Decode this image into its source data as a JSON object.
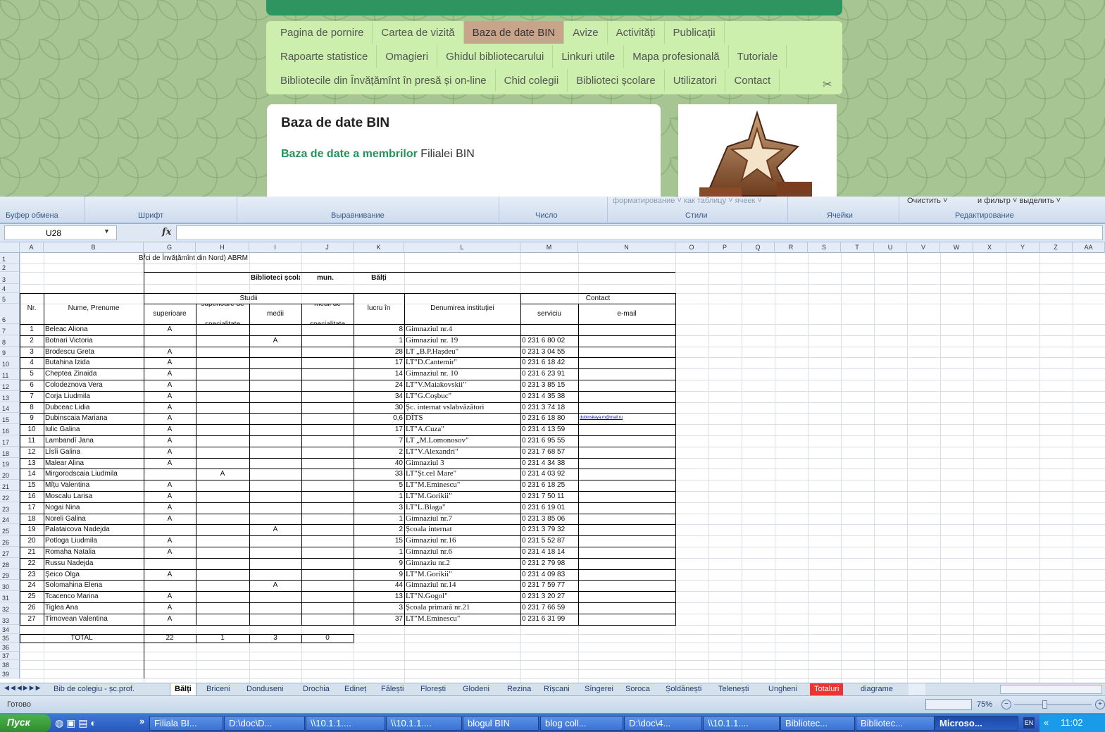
{
  "web": {
    "nav_row1": [
      "Pagina de pornire",
      "Cartea de vizită",
      "Baza de date BIN",
      "Avize",
      "Activități",
      "Publicații"
    ],
    "nav_row2": [
      "Rapoarte statistice",
      "Omagieri",
      "Ghidul bibliotecarului",
      "Linkuri utile",
      "Mapa profesională",
      "Tutoriale"
    ],
    "nav_row3": [
      "Bibliotecile din Învățămînt în presă și on-line",
      "Chid colegii",
      "Biblioteci școlare",
      "Utilizatori",
      "Contact"
    ],
    "active_nav": "Baza de date BIN",
    "content_title": "Baza de date BIN",
    "content_sub_bold": "Baza de date a membrilor",
    "content_sub_rest": " Filialei BIN"
  },
  "ribbon": {
    "groups": [
      "Буфер обмена",
      "Шрифт",
      "Выравнивание",
      "Число",
      "Стили",
      "Ячейки",
      "Редактирование"
    ],
    "styles_text": "форматирование ˅  как таблицу ˅  ячеек ˅",
    "clear_text": "Очистить ˅",
    "filter_text": "и фильтр ˅  выделить ˅"
  },
  "formula_bar": {
    "name_box": "U28",
    "fx": "fx"
  },
  "sheet": {
    "columns": [
      "A",
      "B",
      "G",
      "H",
      "I",
      "J",
      "K",
      "L",
      "M",
      "N",
      "O",
      "P",
      "Q",
      "R",
      "S",
      "T",
      "U",
      "V",
      "W",
      "X",
      "Y",
      "Z",
      "AA"
    ],
    "title1": "B/ci de Învățămînt din Nord) ABRM",
    "title_bs": "Biblioteci școlare",
    "title_mun": "mun.",
    "title_city": "Bălți",
    "hdr_nr": "Nr.",
    "hdr_name": "Nume, Prenume",
    "hdr_studii": "Studii",
    "hdr_sup": "superioare",
    "hdr_supspec": "superioare de specialitate",
    "hdr_medii": "medii",
    "hdr_mediispec": "medii de specialitate",
    "hdr_vechime": "Vechimea de lucru în domeniu",
    "hdr_denumirea": "Denumirea instituției",
    "hdr_contact": "Contact",
    "hdr_serviciu": "serviciu",
    "hdr_email": "e-mail",
    "rows": [
      [
        "1",
        "Beleac Aliona",
        "A",
        "",
        "",
        "",
        "8",
        "Gimnaziul nr.4",
        "",
        ""
      ],
      [
        "2",
        "Botnari Victoria",
        "",
        "",
        "A",
        "",
        "1",
        "Gimnaziul nr. 19",
        "0 231 6 80 02",
        ""
      ],
      [
        "3",
        "Brodescu Greta",
        "A",
        "",
        "",
        "",
        "28",
        "LT „B.P.Hașdeu\"",
        "0 231 3 04 55",
        ""
      ],
      [
        "4",
        "Butahina Izida",
        "A",
        "",
        "",
        "",
        "17",
        "LT\"D.Cantemir\"",
        "0 231 6 18 42",
        ""
      ],
      [
        "5",
        "Cheptea Zinaida",
        "A",
        "",
        "",
        "",
        "14",
        "Gimnaziul nr. 10",
        "0 231 6 23 91",
        ""
      ],
      [
        "6",
        "Colodeznova Vera",
        "A",
        "",
        "",
        "",
        "24",
        "LT\"V.Maiakovskii\"",
        "0 231 3 85 15",
        ""
      ],
      [
        "7",
        "Corja Liudmila",
        "A",
        "",
        "",
        "",
        "34",
        "LT\"G.Coșbuc\"",
        "0 231 4 35 38",
        ""
      ],
      [
        "8",
        "Dubceac Lidia",
        "A",
        "",
        "",
        "",
        "30",
        "Șc. internat  vslabvăzători",
        "0 231 3 74 18",
        ""
      ],
      [
        "9",
        "Dubinscaia Mariana",
        "A",
        "",
        "",
        "",
        "0,6",
        "DÎTS",
        "0 231 6 18 80",
        "dubinskaya.m@mail.ru"
      ],
      [
        "10",
        "Iulic Galina",
        "A",
        "",
        "",
        "",
        "17",
        "LT\"A.Cuza\"",
        "0 231 4 13 59",
        ""
      ],
      [
        "11",
        "Lambandî Jana",
        "A",
        "",
        "",
        "",
        "7",
        "LT „M.Lomonosov\"",
        "0 231 6 95 55",
        ""
      ],
      [
        "12",
        "Lîsîi Galina",
        "A",
        "",
        "",
        "",
        "2",
        "LT\"V.Alexandri\"",
        "0 231 7 68 57",
        ""
      ],
      [
        "13",
        "Malear Alina",
        "A",
        "",
        "",
        "",
        "40",
        "Gimnaziul 3",
        "0 231 4 34 38",
        ""
      ],
      [
        "14",
        "Mirgorodscaia Liudmila",
        "",
        "A",
        "",
        "",
        "33",
        "LT\"Șt.cel Mare\"",
        "0 231 4 03 92",
        ""
      ],
      [
        "15",
        "Mîțu Valentina",
        "A",
        "",
        "",
        "",
        "5",
        "LT\"M.Eminescu\"",
        "0 231 6 18 25",
        ""
      ],
      [
        "16",
        "Moscalu Larisa",
        "A",
        "",
        "",
        "",
        "1",
        "LT\"M.Gorikii\"",
        "0 231 7 50 11",
        ""
      ],
      [
        "17",
        "Nogai Nina",
        "A",
        "",
        "",
        "",
        "3",
        "LT\"L.Blaga\"",
        "0 231 6 19 01",
        ""
      ],
      [
        "18",
        "Noreli Galina",
        "A",
        "",
        "",
        "",
        "1",
        "Gimnaziul nr.7",
        "0 231 3 85 06",
        ""
      ],
      [
        "19",
        "Palataicova Nadejda",
        "",
        "",
        "A",
        "",
        "2",
        "Școala internat",
        "0 231 3 79 32",
        ""
      ],
      [
        "20",
        "Potloga Liudmila",
        "A",
        "",
        "",
        "",
        "15",
        "Gimnaziul nr.16",
        "0 231 5 52 87",
        ""
      ],
      [
        "21",
        "Romaha Natalia",
        "A",
        "",
        "",
        "",
        "1",
        "Gimnaziul nr.6",
        "0 231 4 18 14",
        ""
      ],
      [
        "22",
        "Russu Nadejda",
        "",
        "",
        "",
        "",
        "9",
        "Gimnaziu nr.2",
        "0 231 2 79 98",
        ""
      ],
      [
        "23",
        "Șeico Olga",
        "A",
        "",
        "",
        "",
        "9",
        "LT\"M.Gorikii\"",
        "0 231 4 09 83",
        ""
      ],
      [
        "24",
        "Solomahina Elena",
        "",
        "",
        "A",
        "",
        "44",
        "Gimnaziul nr.14",
        "0 231 7 59 77",
        ""
      ],
      [
        "25",
        "Tcacenco Marina",
        "A",
        "",
        "",
        "",
        "13",
        "LT\"N.Gogol\"",
        "0 231 3 20 27",
        ""
      ],
      [
        "26",
        "Tiglea Ana",
        "A",
        "",
        "",
        "",
        "3",
        "Școala primară nr.21",
        "0 231 7 66 59",
        ""
      ],
      [
        "27",
        "Tîrnovean Valentina",
        "A",
        "",
        "",
        "",
        "37",
        "LT\"M.Eminescu\"",
        "0 231 6 31 99",
        ""
      ]
    ],
    "total_label": "TOTAL",
    "totals": [
      "22",
      "1",
      "3",
      "0"
    ]
  },
  "tabs": [
    "Bib de colegiu - șc.prof.",
    "Bălți",
    "Briceni",
    "Donduseni",
    "Drochia",
    "Edineț",
    "Fălești",
    "Florești",
    "Glodeni",
    "Rezina",
    "Rîșcani",
    "Sîngerei",
    "Soroca",
    "Șoldănești",
    "Telenești",
    "Ungheni",
    "Totaluri",
    "diagrame"
  ],
  "active_tab": "Bălți",
  "red_tab": "Totaluri",
  "status": {
    "ready": "Готово",
    "zoom": "75%"
  },
  "taskbar": {
    "start": "Пуск",
    "buttons": [
      "Filiala BI...",
      "D:\\doc\\D...",
      "\\\\10.1.1....",
      "\\\\10.1.1....",
      "blogul BIN",
      "blog coll...",
      "D:\\doc\\4...",
      "\\\\10.1.1....",
      "Bibliotec...",
      "Bibliotec...",
      "Microso..."
    ],
    "lang": "EN",
    "time": "11:02"
  }
}
